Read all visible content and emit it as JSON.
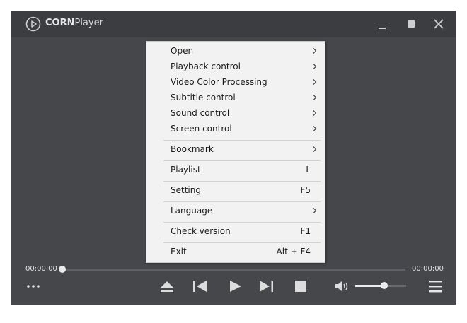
{
  "app": {
    "title_bold": "CORN",
    "title_rest": "Player"
  },
  "window_controls": {
    "minimize": "minimize-icon",
    "maximize": "maximize-icon",
    "close": "close-icon"
  },
  "menu": {
    "items": [
      {
        "label": "Open",
        "submenu": true,
        "shortcut": ""
      },
      {
        "label": "Playback control",
        "submenu": true,
        "shortcut": ""
      },
      {
        "label": "Video Color Processing",
        "submenu": true,
        "shortcut": ""
      },
      {
        "label": "Subtitle control",
        "submenu": true,
        "shortcut": ""
      },
      {
        "label": "Sound control",
        "submenu": true,
        "shortcut": ""
      },
      {
        "label": "Screen control",
        "submenu": true,
        "shortcut": ""
      },
      {
        "label": "Bookmark",
        "submenu": true,
        "shortcut": ""
      },
      {
        "label": "Playlist",
        "submenu": false,
        "shortcut": "L"
      },
      {
        "label": "Setting",
        "submenu": false,
        "shortcut": "F5"
      },
      {
        "label": "Language",
        "submenu": true,
        "shortcut": ""
      },
      {
        "label": "Check version",
        "submenu": false,
        "shortcut": "F1"
      },
      {
        "label": "Exit",
        "submenu": false,
        "shortcut": "Alt + F4"
      }
    ]
  },
  "playback": {
    "current_time": "00:00:00",
    "total_time": "00:00:00",
    "progress_fraction": 0,
    "volume_fraction": 0.57
  },
  "controls": {
    "more": "more-dots-icon",
    "eject": "eject-icon",
    "previous": "previous-icon",
    "play": "play-icon",
    "next": "next-icon",
    "stop": "stop-icon",
    "volume": "volume-icon",
    "playlist_menu": "hamburger-menu-icon"
  },
  "colors": {
    "background": "#46474b",
    "titlebar": "#3c3d41",
    "menu_bg": "#f2f2f2",
    "accent": "#e8e8e8"
  }
}
